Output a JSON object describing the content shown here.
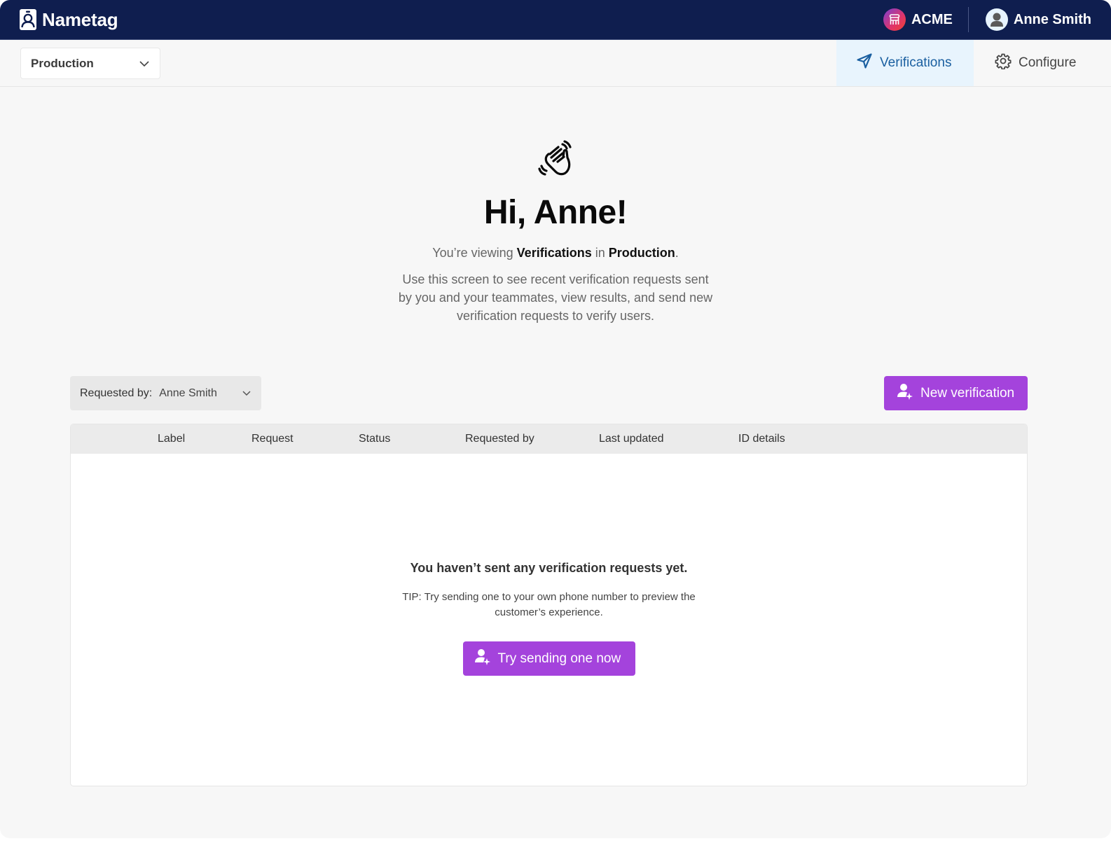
{
  "header": {
    "app_name": "Nametag",
    "org_name": "ACME",
    "user_name": "Anne Smith",
    "icons": {
      "logo": "nametag-logo-icon",
      "org": "storefront-icon",
      "user": "user-avatar-icon"
    }
  },
  "subheader": {
    "environment_selected": "Production",
    "nav": [
      {
        "label": "Verifications",
        "icon": "paper-plane-icon",
        "active": true
      },
      {
        "label": "Configure",
        "icon": "gear-icon",
        "active": false
      }
    ]
  },
  "hero": {
    "icon": "waving-hand-icon",
    "greeting": "Hi, Anne!",
    "viewing_prefix": "You’re viewing ",
    "viewing_section": "Verifications",
    "viewing_middle": " in ",
    "viewing_env": "Production",
    "viewing_suffix": ".",
    "description": "Use this screen to see recent verification requests sent by you and your teammates, view results, and send new verification requests to verify users."
  },
  "controls": {
    "filter_label": "Requested by:",
    "filter_value": "Anne Smith",
    "new_verification_label": "New verification"
  },
  "table": {
    "columns": [
      "Label",
      "Request",
      "Status",
      "Requested by",
      "Last updated",
      "ID details"
    ],
    "rows": [],
    "empty_title": "You haven’t sent any verification requests yet.",
    "empty_tip": "TIP: Try sending one to your own phone number to preview the customer’s experience.",
    "empty_button_label": "Try sending one now"
  },
  "colors": {
    "header_bg": "#0f1e4f",
    "accent_purple": "#a443dc",
    "active_nav_bg": "#e8f4fd",
    "active_nav_text": "#1a5fa0"
  }
}
